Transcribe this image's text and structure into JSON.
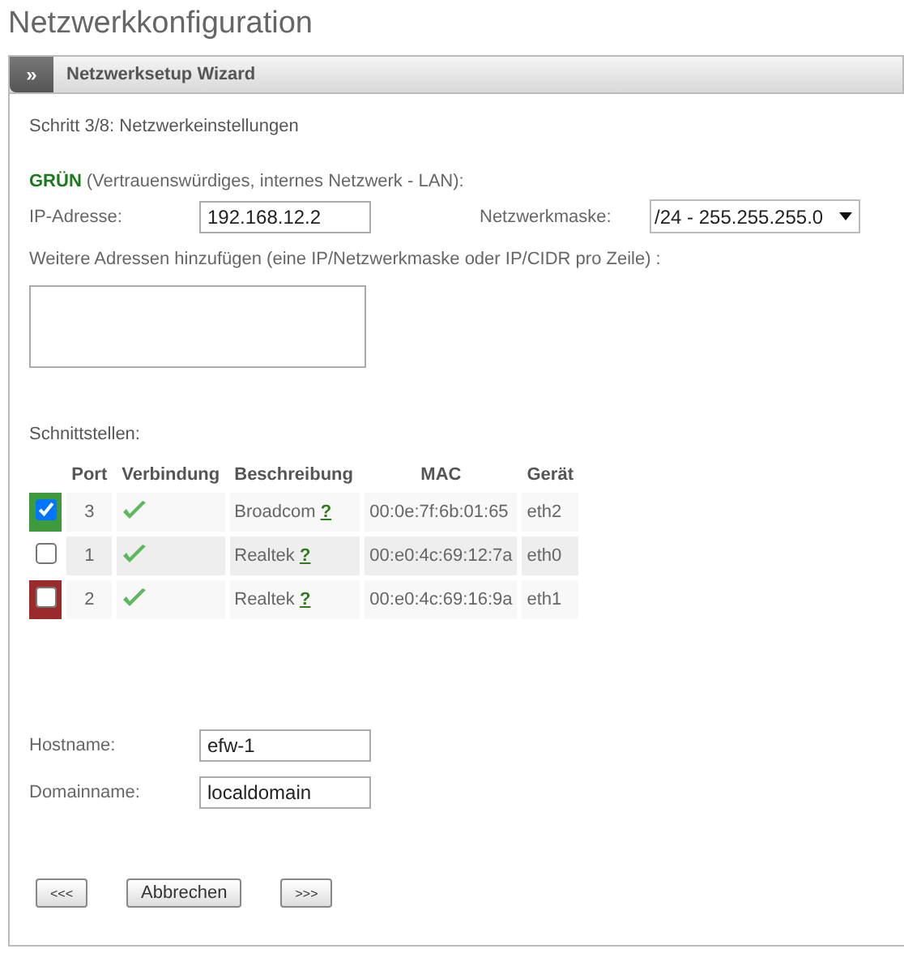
{
  "page_title": "Netzwerkkonfiguration",
  "panel": {
    "toggle": "»",
    "title": "Netzwerksetup Wizard"
  },
  "step": "Schritt 3/8: Netzwerkeinstellungen",
  "zone": {
    "name": "GRÜN",
    "description": "(Vertrauenswürdiges, internes Netzwerk - LAN):"
  },
  "ip": {
    "label": "IP-Adresse:",
    "value": "192.168.12.2"
  },
  "netmask": {
    "label": "Netzwerkmaske:",
    "value": "/24 - 255.255.255.0"
  },
  "extra": {
    "label": "Weitere Adressen hinzufügen (eine IP/Netzwerkmaske oder IP/CIDR pro Zeile) :"
  },
  "interfaces_label": "Schnittstellen:",
  "table": {
    "columns": [
      "Port",
      "Verbindung",
      "Beschreibung",
      "MAC",
      "Gerät"
    ],
    "rows": [
      {
        "checked": true,
        "color": "#3d9a3d",
        "port": "3",
        "connected": true,
        "description": "Broadcom",
        "help": "?",
        "mac": "00:0e:7f:6b:01:65",
        "device": "eth2"
      },
      {
        "checked": false,
        "port": "1",
        "connected": true,
        "description": "Realtek",
        "help": "?",
        "mac": "00:e0:4c:69:12:7a",
        "device": "eth0"
      },
      {
        "checked": false,
        "color": "#9b2b2b",
        "port": "2",
        "connected": true,
        "description": "Realtek",
        "help": "?",
        "mac": "00:e0:4c:69:16:9a",
        "device": "eth1"
      }
    ]
  },
  "hostname": {
    "label": "Hostname:",
    "value": "efw-1"
  },
  "domainname": {
    "label": "Domainname:",
    "value": "localdomain"
  },
  "buttons": [
    "<<<",
    "Abbrechen",
    ">>>"
  ]
}
